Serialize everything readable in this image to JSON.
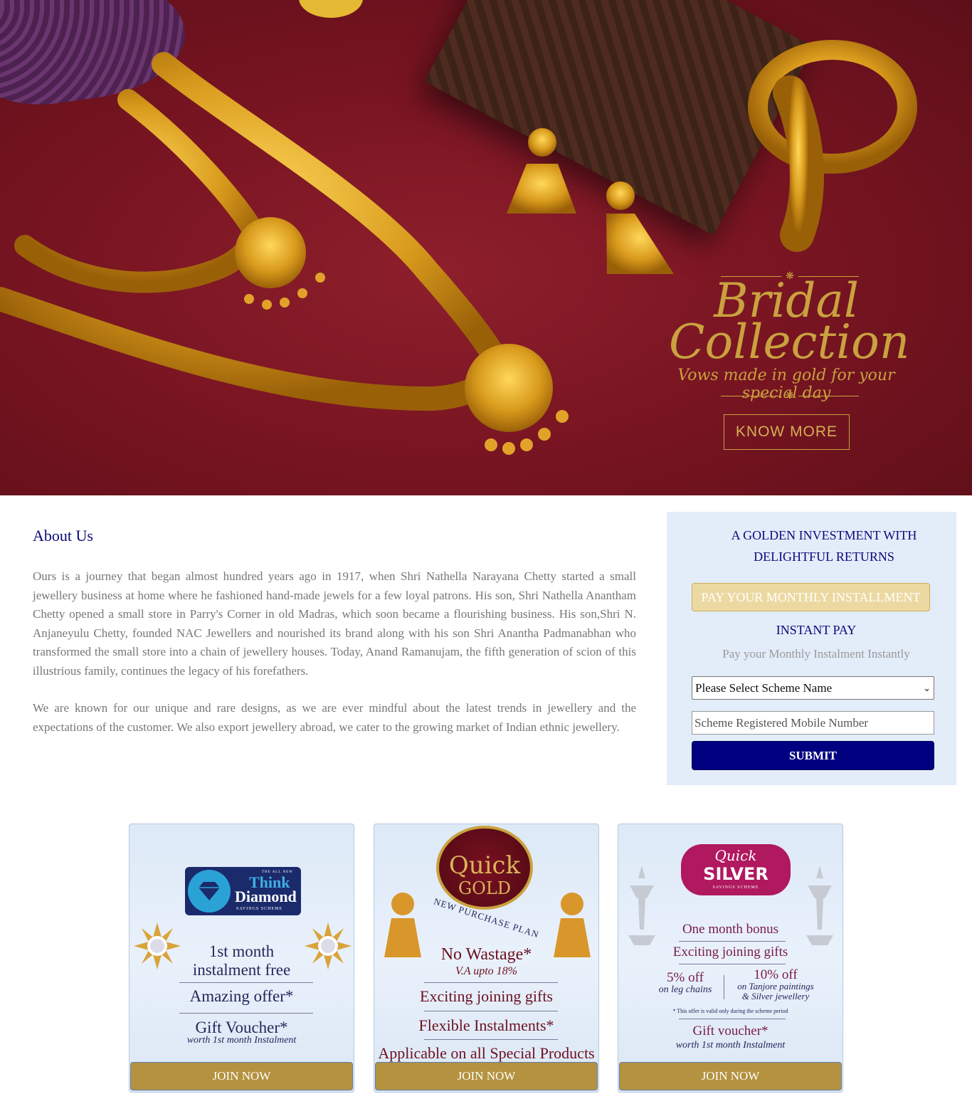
{
  "hero": {
    "title_line1": "Bridal",
    "title_line2": "Collection",
    "tagline": "Vows made in gold for your special day",
    "cta": "KNOW MORE"
  },
  "about": {
    "title": "About Us",
    "para1": "Ours is a journey that began almost hundred years ago in 1917, when Shri Nathella Narayana Chetty started a small jewellery business at home where he fashioned hand-made jewels for a few loyal patrons. His son, Shri Nathella Anantham Chetty opened a small store in Parry's Corner in old Madras, which soon became a flourishing business. His son,Shri N. Anjaneyulu Chetty, founded NAC Jewellers and nourished its brand along with his son Shri Anantha Padmanabhan who transformed the small store into a chain of jewellery houses. Today, Anand Ramanujam, the fifth generation of scion of this illustrious family, continues the legacy of his forefathers.",
    "para2": "We are known for our unique and rare designs, as we are ever mindful about the latest trends in jewellery and the expectations of the customer. We also export jewellery abroad, we cater to the growing market of Indian ethnic jewellery."
  },
  "panel": {
    "heading_line1": "A GOLDEN INVESTMENT WITH",
    "heading_line2": "DELIGHTFUL RETURNS",
    "pay_button": "PAY YOUR MONTHLY INSTALLMENT",
    "instant_title": "INSTANT PAY",
    "instant_sub": "Pay your Monthly Instalment Instantly",
    "select_value": "Please Select Scheme Name",
    "mobile_placeholder": "Scheme Registered Mobile Number",
    "submit": "SUBMIT"
  },
  "cards": {
    "diamond": {
      "logo_top": "THE ALL NEW",
      "logo_line1": "Think",
      "logo_line2": "Diamond",
      "logo_sub": "SAVINGS SCHEME",
      "line1": "1st month",
      "line2": "instalment free",
      "offer": "Amazing offer*",
      "voucher": "Gift Voucher*",
      "voucher_sub": "worth 1st month Instalment",
      "join": "JOIN NOW"
    },
    "gold": {
      "logo_line1": "Quick",
      "logo_line2": "GOLD",
      "arc": "NEW PURCHASE PLAN",
      "wastage": "No Wastage*",
      "va": "V.A upto 18%",
      "gifts": "Exciting joining gifts",
      "flex": "Flexible Instalments*",
      "applicable": "Applicable on all Special Products",
      "join": "JOIN NOW"
    },
    "silver": {
      "logo_line1": "Quick",
      "logo_line2": "SILVER",
      "logo_sub": "SAVINGS SCHEME",
      "bonus": "One month bonus",
      "gifts": "Exciting joining gifts",
      "off1": "5% off",
      "off1_sub": "on leg chains",
      "off2": "10% off",
      "off2_sub1": "on Tanjore paintings",
      "off2_sub2": "& Silver jewellery",
      "note": "* This offer is valid only during the scheme period",
      "voucher": "Gift voucher*",
      "voucher_sub": "worth 1st month Instalment",
      "join": "JOIN NOW"
    }
  },
  "colors": {
    "navy": "#000080",
    "gold": "#b4923f",
    "maroon": "#7a1522",
    "panel_bg": "#e3ecf9"
  }
}
